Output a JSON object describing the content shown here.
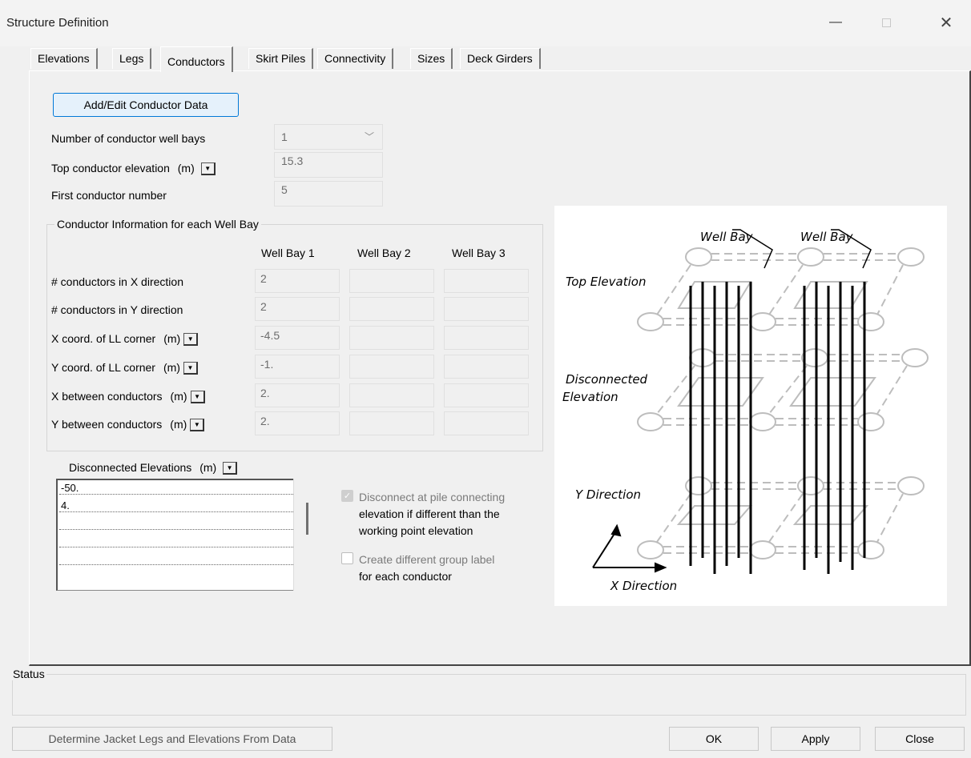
{
  "window": {
    "title": "Structure Definition",
    "minimize_glyph": "—",
    "close_glyph": "✕"
  },
  "tabs": [
    {
      "label": "Elevations"
    },
    {
      "label": "Legs"
    },
    {
      "label": "Conductors",
      "active": true
    },
    {
      "label": "Skirt Piles"
    },
    {
      "label": "Connectivity"
    },
    {
      "label": "Sizes"
    },
    {
      "label": "Deck Girders"
    }
  ],
  "conductors": {
    "add_edit_button": "Add/Edit Conductor Data",
    "num_well_bays_label": "Number of conductor well bays",
    "num_well_bays_value": "1",
    "top_elevation_label": "Top conductor elevation",
    "top_elevation_unit": "(m)",
    "top_elevation_value": "15.3",
    "first_number_label": "First conductor number",
    "first_number_value": "5",
    "group_title": "Conductor Information for each Well Bay",
    "columns": [
      "Well Bay 1",
      "Well Bay 2",
      "Well Bay 3"
    ],
    "rows": [
      {
        "label": "# conductors in X direction",
        "unit": "",
        "values": [
          "2",
          "",
          ""
        ]
      },
      {
        "label": "# conductors in Y direction",
        "unit": "",
        "values": [
          "2",
          "",
          ""
        ]
      },
      {
        "label": "X coord. of LL corner",
        "unit": "(m)",
        "values": [
          "-4.5",
          "",
          ""
        ]
      },
      {
        "label": "Y coord. of LL corner",
        "unit": "(m)",
        "values": [
          "-1.",
          "",
          ""
        ]
      },
      {
        "label": "X between conductors",
        "unit": "(m)",
        "values": [
          "2.",
          "",
          ""
        ]
      },
      {
        "label": "Y between conductors",
        "unit": "(m)",
        "values": [
          "2.",
          "",
          ""
        ]
      }
    ],
    "disconnected_label": "Disconnected Elevations",
    "disconnected_unit": "(m)",
    "disconnected_values": [
      "-50.",
      "4.",
      "",
      "",
      ""
    ],
    "checkbox1_label_lines": [
      "Disconnect at pile connecting",
      "elevation if different than the",
      "working point elevation"
    ],
    "checkbox1_checked": true,
    "checkbox2_label_lines": [
      "Create different group label",
      "for each conductor"
    ],
    "checkbox2_checked": false
  },
  "diagram": {
    "labels": {
      "well_bay_1": "Well Bay",
      "well_bay_2": "Well Bay",
      "top_elevation": "Top Elevation",
      "disconnected_1": "Disconnected",
      "disconnected_2": "Elevation",
      "y_direction": "Y Direction",
      "x_direction": "X Direction"
    }
  },
  "status": {
    "label": "Status",
    "text": ""
  },
  "footer": {
    "determine_button": "Determine Jacket Legs and Elevations From Data",
    "ok_button": "OK",
    "apply_button": "Apply",
    "close_button": "Close"
  }
}
